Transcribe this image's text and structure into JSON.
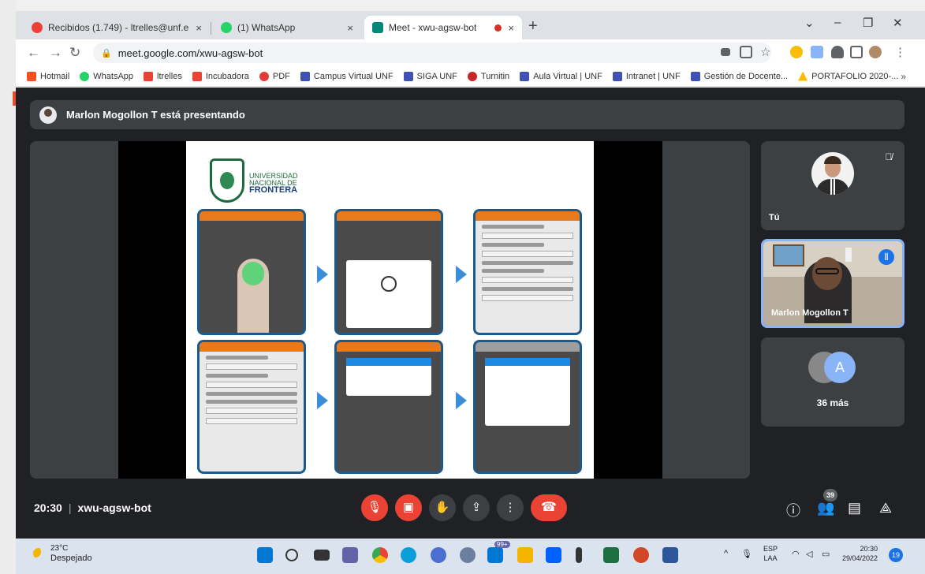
{
  "browser": {
    "tabs": [
      {
        "title": "Recibidos (1.749) - ltrelles@unf.e",
        "favicon_color": "#ea4335",
        "active": false
      },
      {
        "title": "(1) WhatsApp",
        "favicon_color": "#25d366",
        "active": false
      },
      {
        "title": "Meet - xwu-agsw-bot",
        "favicon_color": "#00897b",
        "active": true
      }
    ],
    "close_glyph": "×",
    "new_tab": "+",
    "url": "meet.google.com/xwu-agsw-bot",
    "bookmarks": [
      {
        "label": "Hotmail",
        "color": "#f25022"
      },
      {
        "label": "WhatsApp",
        "color": "#25d366"
      },
      {
        "label": "ltrelles",
        "color": "#ea4335"
      },
      {
        "label": "Incubadora",
        "color": "#ea4335"
      },
      {
        "label": "PDF",
        "color": "#e53935"
      },
      {
        "label": "Campus Virtual UNF",
        "color": "#3f51b5"
      },
      {
        "label": "SIGA UNF",
        "color": "#3f51b5"
      },
      {
        "label": "Turnitin",
        "color": "#c62828"
      },
      {
        "label": "Aula Virtual | UNF",
        "color": "#3f51b5"
      },
      {
        "label": "Intranet | UNF",
        "color": "#3f51b5"
      },
      {
        "label": "Gestión de Docente...",
        "color": "#3f51b5"
      },
      {
        "label": "PORTAFOLIO 2020-...",
        "color": "#fbbc04"
      }
    ],
    "bookmarks_more": "»"
  },
  "meet": {
    "presenting_text": "Marlon Mogollon T está presentando",
    "slide": {
      "university_line1": "UNIVERSIDAD",
      "university_line2": "NACIONAL DE",
      "university_line3": "FRONTERA"
    },
    "self_tile_label": "Tú",
    "speaker_tile_label": "Marlon Mogollon T",
    "others_avatar_letter": "A",
    "others_count_text": "36 más",
    "meeting_time": "20:30",
    "meeting_code": "xwu-agsw-bot",
    "participants_badge": "39"
  },
  "taskbar": {
    "temperature": "23°C",
    "weather": "Despejado",
    "store_badge": "99+",
    "lang_line1": "ESP",
    "lang_line2": "LAA",
    "time": "20:30",
    "date": "29/04/2022",
    "notifications": "19"
  }
}
